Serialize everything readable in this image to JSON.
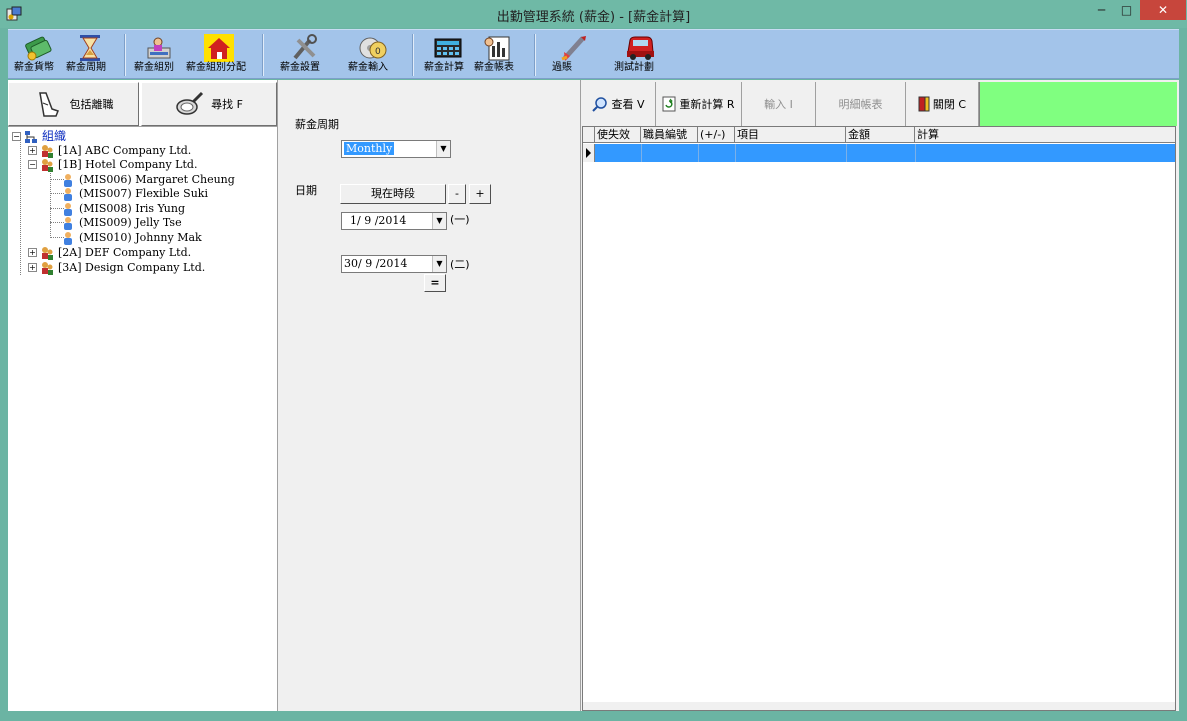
{
  "window": {
    "title": "出勤管理系統  (薪金) - [薪金計算]",
    "minimize": "─",
    "maximize": "□",
    "close": "✕"
  },
  "toolbar": [
    {
      "label": "薪金貨幣",
      "icon": "currency-icon"
    },
    {
      "label": "薪金周期",
      "icon": "hourglass-icon"
    },
    {
      "label": "薪金組別",
      "icon": "group-icon"
    },
    {
      "label": "薪金組別分配",
      "icon": "house-icon"
    },
    {
      "label": "薪金設置",
      "icon": "tools-icon"
    },
    {
      "label": "薪金輸入",
      "icon": "cd-input-icon"
    },
    {
      "label": "薪金計算",
      "icon": "calculator-icon"
    },
    {
      "label": "薪金帳表",
      "icon": "report-icon"
    },
    {
      "label": "過賬",
      "icon": "rocket-icon"
    },
    {
      "label": "測試計劃",
      "icon": "bus-icon"
    }
  ],
  "left": {
    "include_resigned": "包括離職",
    "find": "尋找 F"
  },
  "tree": {
    "root": "組織",
    "nodes": [
      {
        "label": "[1A]  ABC Company Ltd.",
        "type": "company",
        "expand": "+"
      },
      {
        "label": "[1B]  Hotel Company Ltd.",
        "type": "company",
        "expand": "−"
      },
      {
        "label": "(MIS006)  Margaret Cheung",
        "type": "employee"
      },
      {
        "label": "(MIS007)  Flexible Suki",
        "type": "employee"
      },
      {
        "label": "(MIS008)  Iris Yung",
        "type": "employee"
      },
      {
        "label": "(MIS009)  Jelly Tse",
        "type": "employee"
      },
      {
        "label": "(MIS010)  Johnny Mak",
        "type": "employee"
      },
      {
        "label": "[2A]  DEF Company Ltd.",
        "type": "company",
        "expand": "+"
      },
      {
        "label": "[3A]  Design Company Ltd.",
        "type": "company",
        "expand": "+"
      }
    ]
  },
  "middle": {
    "period_label": "薪金周期",
    "period_value": "Monthly",
    "date_label": "日期",
    "current_period_button": "現在時段",
    "minus": "-",
    "plus": "+",
    "date_from": "1/ 9 /2014",
    "date_from_suffix": "(一)",
    "date_to": "30/ 9 /2014",
    "date_to_suffix": "(二)",
    "equals": "="
  },
  "right": {
    "buttons": {
      "view": "查看 V",
      "recalc": "重新計算 R",
      "input": "輸入 I",
      "detail": "明細帳表",
      "close": "關閉 C"
    },
    "grid_columns": [
      "使失效",
      "職員編號",
      "(+/-)",
      "項目",
      "金額",
      "計算"
    ]
  }
}
